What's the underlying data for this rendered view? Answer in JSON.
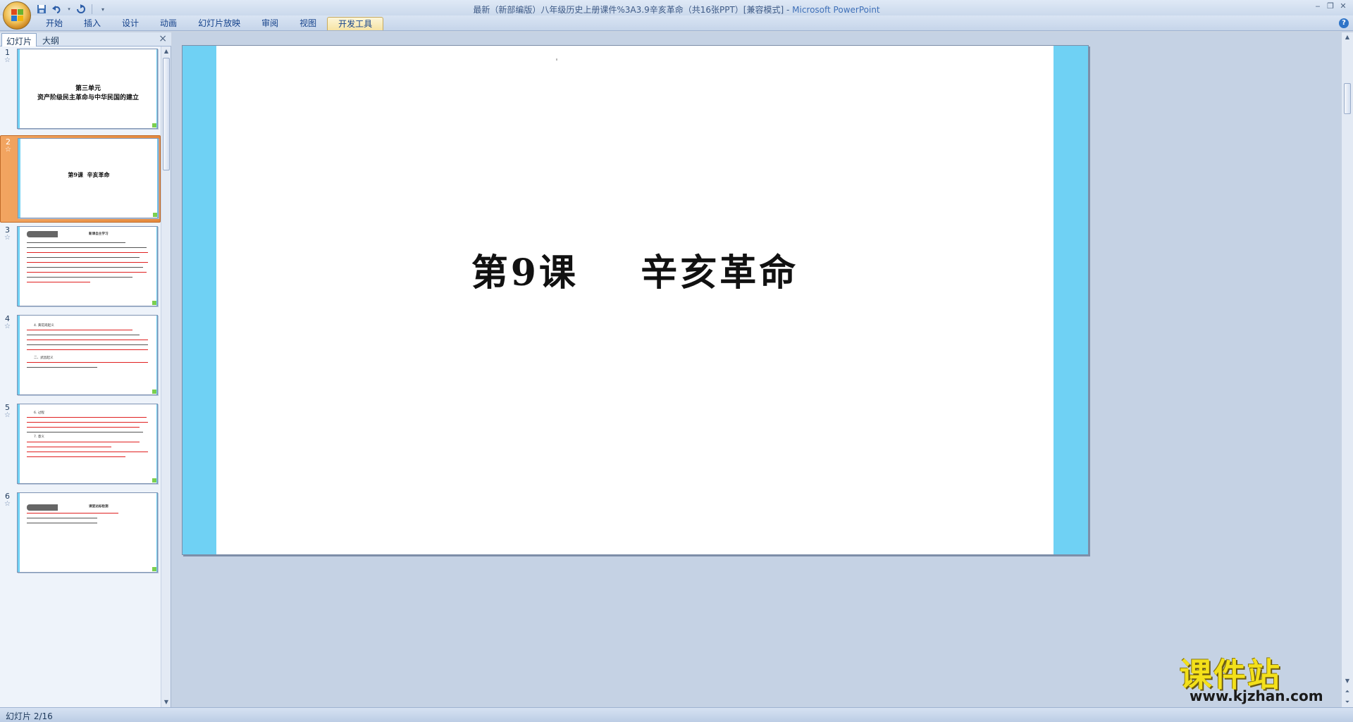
{
  "window": {
    "title": "最新（新部编版）八年级历史上册课件%3A3.9辛亥革命（共16张PPT）[兼容模式]",
    "title_sep": " - ",
    "app_name": "Microsoft PowerPoint",
    "controls": [
      "‒",
      "❐",
      "✕"
    ]
  },
  "quick_access": {
    "icons": [
      "save-icon",
      "undo-icon",
      "redo-icon",
      "customize-icon"
    ]
  },
  "ribbon": {
    "tabs": [
      "开始",
      "插入",
      "设计",
      "动画",
      "幻灯片放映",
      "审阅",
      "视图",
      "开发工具"
    ],
    "active_tab": "开发工具",
    "help": "?"
  },
  "left_pane": {
    "tabs": [
      "幻灯片",
      "大纲"
    ],
    "close": "×"
  },
  "slides": [
    {
      "number": "1",
      "star": "☆",
      "lines": [
        "第三单元",
        "资产阶级民主革命与中华民国的建立"
      ]
    },
    {
      "number": "2",
      "star": "☆",
      "lines": [
        "第9课  辛亥革命"
      ]
    },
    {
      "number": "3",
      "star": "☆",
      "lines": [
        "新课自主学习"
      ]
    },
    {
      "number": "4",
      "star": "☆",
      "lines": [
        "4. 黄花岗起义",
        "二、武昌起义"
      ]
    },
    {
      "number": "5",
      "star": "☆",
      "lines": [
        "6. 过程",
        "7. 意义"
      ]
    },
    {
      "number": "6",
      "star": "☆",
      "lines": [
        "课堂达标检测"
      ]
    }
  ],
  "current_slide": {
    "title": "第9课    辛亥革命",
    "accent_color": "#6fd1f4"
  },
  "watermark": {
    "big": "课件站",
    "small": "www.kjzhan.com"
  },
  "status": {
    "slide_counter": "幻灯片 2/16"
  }
}
